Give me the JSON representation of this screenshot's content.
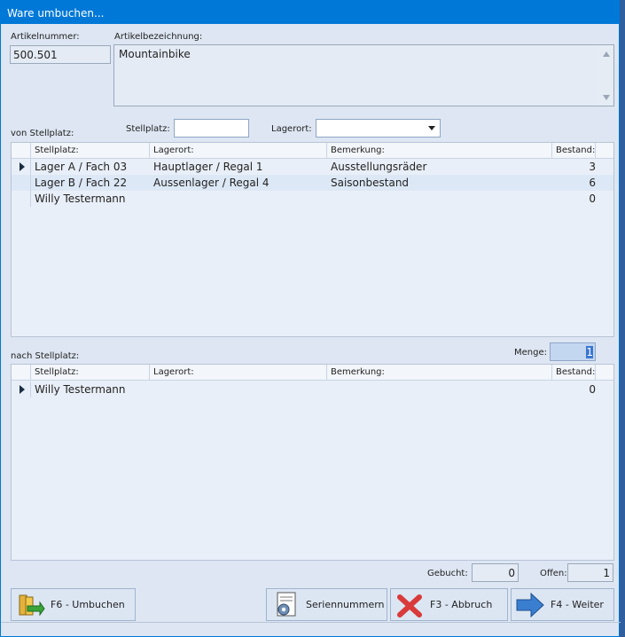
{
  "window": {
    "title": "Ware umbuchen..."
  },
  "article": {
    "number_label": "Artikelnummer:",
    "number_value": "500.501",
    "desc_label": "Artikelbezeichnung:",
    "desc_value": "Mountainbike"
  },
  "from": {
    "section_label": "von Stellplatz:",
    "stellplatz_label": "Stellplatz:",
    "stellplatz_value": "",
    "lagerort_label": "Lagerort:",
    "lagerort_value": "",
    "columns": [
      "Stellplatz:",
      "Lagerort:",
      "Bemerkung:",
      "Bestand:"
    ],
    "rows": [
      {
        "stellplatz": "Lager A / Fach 03",
        "lagerort": "Hauptlager / Regal 1",
        "bemerkung": "Ausstellungsräder",
        "bestand": "3"
      },
      {
        "stellplatz": "Lager B / Fach 22",
        "lagerort": "Aussenlager / Regal 4",
        "bemerkung": "Saisonbestand",
        "bestand": "6"
      },
      {
        "stellplatz": "Willy Testermann",
        "lagerort": "",
        "bemerkung": "",
        "bestand": "0"
      }
    ]
  },
  "to": {
    "section_label": "nach Stellplatz:",
    "menge_label": "Menge:",
    "menge_value": "1",
    "columns": [
      "Stellplatz:",
      "Lagerort:",
      "Bemerkung:",
      "Bestand:"
    ],
    "rows": [
      {
        "stellplatz": "Willy Testermann",
        "lagerort": "",
        "bemerkung": "",
        "bestand": "0"
      }
    ]
  },
  "totals": {
    "gebucht_label": "Gebucht:",
    "gebucht_value": "0",
    "offen_label": "Offen:",
    "offen_value": "1"
  },
  "buttons": {
    "umbuchen": "F6 - Umbuchen",
    "seriennummern": "Seriennummern",
    "abbruch": "F3 - Abbruch",
    "weiter": "F4 - Weiter"
  },
  "colors": {
    "title_bar": "#0078d7",
    "window_bg": "#dde6f2",
    "selected_row": "#dde8f6",
    "cancel_red": "#d93a3a",
    "next_blue": "#3a7ed0"
  }
}
